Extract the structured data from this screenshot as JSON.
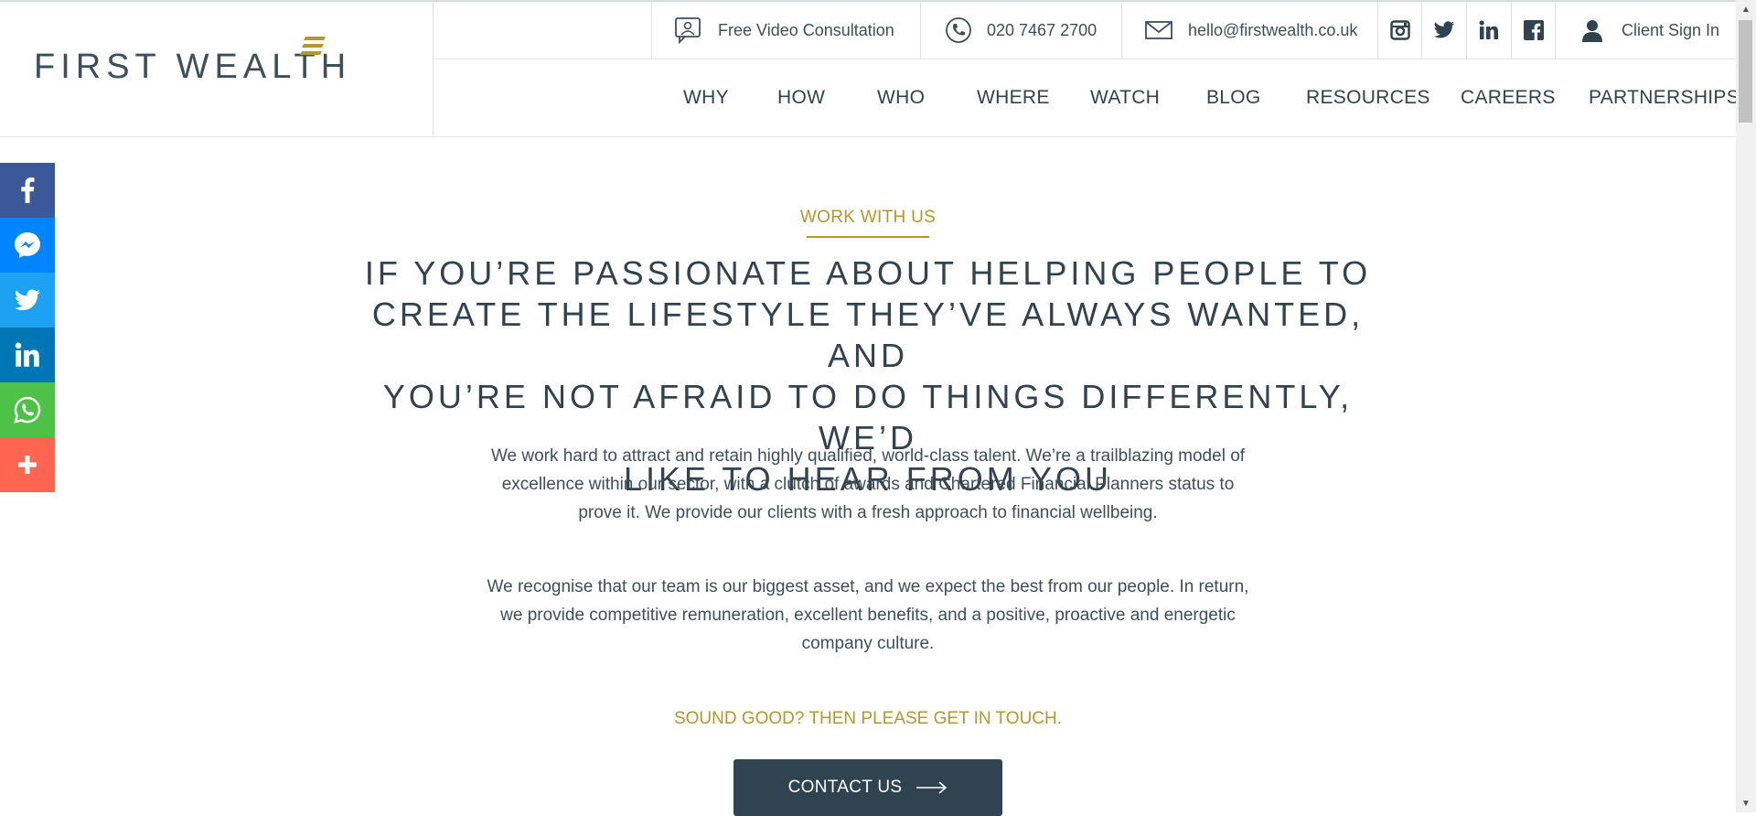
{
  "brand": {
    "name": "FIRST WEALTH",
    "accent_color": "#b7962b",
    "primary_color": "#2f4350"
  },
  "utility_bar": {
    "consultation": {
      "icon": "video-chat-icon",
      "label": "Free Video Consultation"
    },
    "phone": {
      "icon": "phone-icon",
      "label": "020 7467 2700"
    },
    "email": {
      "icon": "envelope-icon",
      "label": "hello@firstwealth.co.uk"
    },
    "social": [
      {
        "icon": "instagram-icon"
      },
      {
        "icon": "twitter-icon"
      },
      {
        "icon": "linkedin-icon"
      },
      {
        "icon": "facebook-icon"
      }
    ],
    "sign_in": {
      "icon": "user-icon",
      "label": "Client Sign In"
    }
  },
  "nav": {
    "items": [
      "WHY",
      "HOW",
      "WHO",
      "WHERE",
      "WATCH",
      "BLOG",
      "RESOURCES",
      "CAREERS",
      "PARTNERSHIPS"
    ]
  },
  "share_bar": [
    {
      "icon": "facebook-icon",
      "color": "#3b5998"
    },
    {
      "icon": "messenger-icon",
      "color": "#0084ff"
    },
    {
      "icon": "twitter-icon",
      "color": "#1da1f2"
    },
    {
      "icon": "linkedin-icon",
      "color": "#0077b5"
    },
    {
      "icon": "whatsapp-icon",
      "color": "#4dc247"
    },
    {
      "icon": "plus-icon",
      "color": "#ff6550"
    }
  ],
  "main": {
    "eyebrow": "WORK WITH US",
    "headline_lines": [
      "IF YOU’RE PASSIONATE ABOUT HELPING PEOPLE TO",
      "CREATE THE LIFESTYLE THEY’VE ALWAYS WANTED, AND",
      "YOU’RE NOT AFRAID TO DO THINGS DIFFERENTLY, WE’D",
      "LIKE TO HEAR FROM YOU"
    ],
    "paragraph_1_lines": [
      "We work hard to attract and retain highly qualified, world-class talent. We’re a trailblazing model of",
      "excellence within our sector, with a clutch of awards and Chartered Financial Planners status to",
      "prove it. We provide our clients with a fresh approach to financial wellbeing."
    ],
    "paragraph_2_lines": [
      "We recognise that our team is our biggest asset, and we expect the best from our people. In return,",
      "we provide competitive remuneration, excellent benefits, and a positive, proactive and energetic",
      "company culture."
    ],
    "cta_text": "SOUND GOOD? THEN PLEASE GET IN TOUCH.",
    "contact_button": "CONTACT US"
  }
}
